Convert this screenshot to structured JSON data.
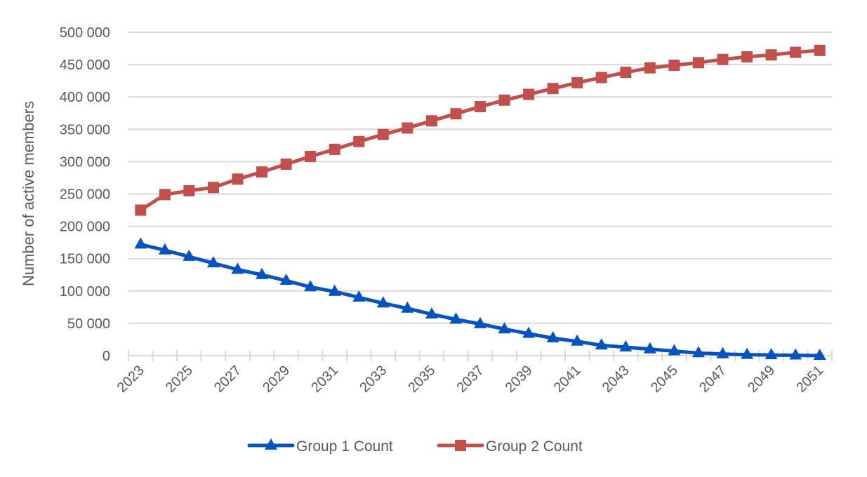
{
  "chart_data": {
    "type": "line",
    "title": "",
    "xlabel": "",
    "ylabel": "Number of active members",
    "ylim": [
      0,
      500000
    ],
    "yticks": [
      0,
      50000,
      100000,
      150000,
      200000,
      250000,
      300000,
      350000,
      400000,
      450000,
      500000
    ],
    "ytick_labels": [
      "0",
      "50 000",
      "100 000",
      "150 000",
      "200 000",
      "250 000",
      "300 000",
      "350 000",
      "400 000",
      "450 000",
      "500 000"
    ],
    "grid": true,
    "legend_position": "bottom",
    "x": [
      2023,
      2024,
      2025,
      2026,
      2027,
      2028,
      2029,
      2030,
      2031,
      2032,
      2033,
      2034,
      2035,
      2036,
      2037,
      2038,
      2039,
      2040,
      2041,
      2042,
      2043,
      2044,
      2045,
      2046,
      2047,
      2048,
      2049,
      2050,
      2051
    ],
    "xtick_labels": [
      "2023",
      "2025",
      "2027",
      "2029",
      "2031",
      "2033",
      "2035",
      "2037",
      "2039",
      "2041",
      "2043",
      "2045",
      "2047",
      "2049",
      "2051"
    ],
    "series": [
      {
        "name": "Group 1 Count",
        "color": "#0652BE",
        "marker": "triangle",
        "values": [
          172000,
          163000,
          153000,
          143000,
          133000,
          125000,
          116000,
          106000,
          99000,
          90000,
          81000,
          73000,
          64000,
          56000,
          49000,
          41000,
          34000,
          27000,
          22000,
          16000,
          13000,
          10000,
          7000,
          4000,
          2500,
          1500,
          1000,
          500,
          0
        ]
      },
      {
        "name": "Group 2 Count",
        "color": "#C0504D",
        "marker": "square",
        "values": [
          225000,
          249000,
          255000,
          260000,
          273000,
          284000,
          296000,
          308000,
          319000,
          331000,
          342000,
          352000,
          363000,
          374000,
          385000,
          395000,
          404000,
          413000,
          422000,
          430000,
          438000,
          445000,
          449000,
          453000,
          458000,
          462000,
          465000,
          469000,
          472000
        ]
      }
    ]
  },
  "colors": {
    "grid": "#D9D9D9",
    "axis_text": "#595959"
  }
}
